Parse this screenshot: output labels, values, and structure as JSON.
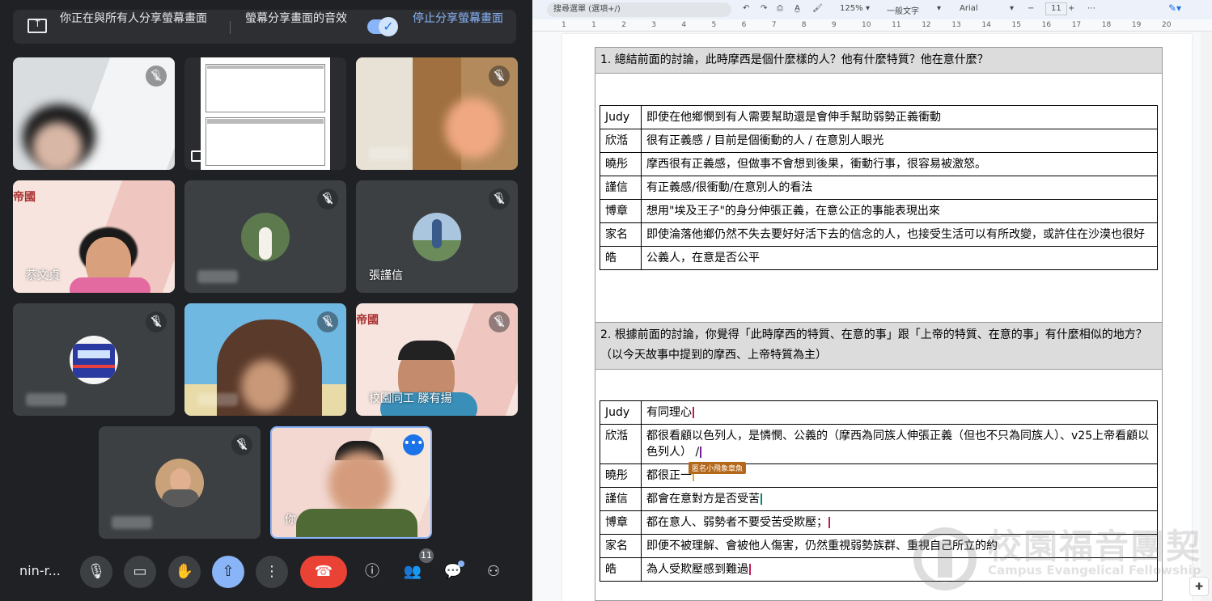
{
  "meet": {
    "banner": {
      "sharing_text": "你正在與所有人分享螢幕畫面",
      "audio_text": "螢幕分享畫面的音效",
      "stop_button": "停止分享螢幕畫面",
      "audio_toggle_on": true
    },
    "tiles": [
      {
        "name": "",
        "muted": true
      },
      {
        "name": "",
        "muted": false
      },
      {
        "name": "",
        "muted": true
      },
      {
        "name": "蔡文貞",
        "muted": false
      },
      {
        "name": "",
        "muted": true
      },
      {
        "name": "張謹信",
        "muted": true
      },
      {
        "name": "",
        "muted": true
      },
      {
        "name": "",
        "muted": true
      },
      {
        "name": "校園同工 滕有揚",
        "muted": true
      },
      {
        "name": "",
        "muted": true
      },
      {
        "name": "你",
        "muted": false
      }
    ],
    "controls": {
      "meeting_code": "nin-r...",
      "participants_count": "11",
      "icons": [
        "mic-icon",
        "camera-icon",
        "raise-hand-icon",
        "present-icon",
        "more-icon",
        "end-call-icon",
        "info-icon",
        "people-icon",
        "chat-icon",
        "activities-icon"
      ]
    }
  },
  "docs": {
    "toolbar": {
      "menu_search": "搜尋選單 (選項+/)",
      "zoom": "125%",
      "style": "一般文字",
      "font": "Arial",
      "font_size": "11",
      "minus": "−",
      "plus": "+",
      "more": "⋯"
    },
    "ruler_ticks": [
      "1",
      "1",
      "2",
      "3",
      "4",
      "5",
      "6",
      "7",
      "8",
      "9",
      "10",
      "11",
      "12",
      "13",
      "14",
      "15",
      "16",
      "17",
      "18",
      "19",
      "20"
    ],
    "q1": {
      "question": "1. 總結前面的討論，此時摩西是個什麼樣的人？他有什麼特質？他在意什麼？",
      "answers": [
        {
          "who": "Judy",
          "text": "即使在他鄉憫到有人需要幫助還是會伸手幫助弱勢正義衝動"
        },
        {
          "who": "欣湉",
          "text": "很有正義感 / 目前是個衝動的人 / 在意別人眼光"
        },
        {
          "who": "曉彤",
          "text": "摩西很有正義感，但做事不會想到後果，衝動行事，很容易被激怒。"
        },
        {
          "who": "謹信",
          "text": "有正義感/很衝動/在意別人的看法"
        },
        {
          "who": "博章",
          "text": "想用\"埃及王子\"的身分伸張正義，在意公正的事能表現出來"
        },
        {
          "who": "家名",
          "text": "即使淪落他鄉仍然不失去要好好活下去的信念的人，也接受生活可以有所改變，或許住在沙漠也很好"
        },
        {
          "who": "皓",
          "text": "公義人，在意是否公平"
        }
      ]
    },
    "q2": {
      "question": "2. 根據前面的討論，你覺得「此時摩西的特質、在意的事」跟「上帝的特質、在意的事」有什麼相似的地方？（以今天故事中提到的摩西、上帝特質為主）",
      "answers": [
        {
          "who": "Judy",
          "text": "有同理心"
        },
        {
          "who": "欣湉",
          "text": "都很看顧以色列人，是憐憫、公義的（摩西為同族人伸張正義（但也不只為同族人）、v25上帝看顧以色列人） /"
        },
        {
          "who": "曉彤",
          "text": "都很正一"
        },
        {
          "who": "謹信",
          "text": "都會在意對方是否受苦"
        },
        {
          "who": "博章",
          "text": "都在意人、弱勢者不要受苦受欺壓；"
        },
        {
          "who": "家名",
          "text": "即便不被理解、會被他人傷害，仍然重視弱勢族群、重視自己所立的約"
        },
        {
          "who": "皓",
          "text": "為人受欺壓感到難過"
        }
      ],
      "collaborator_tag": "匿名小飛象章魚"
    },
    "watermark": {
      "chinese": "校園福音團契",
      "english": "Campus Evangelical Fellowship"
    }
  },
  "colors": {
    "meet_bg": "#202124",
    "accent_blue": "#8ab4f8",
    "end_call_red": "#ea4335",
    "table_header_gray": "#dcdcdc"
  }
}
